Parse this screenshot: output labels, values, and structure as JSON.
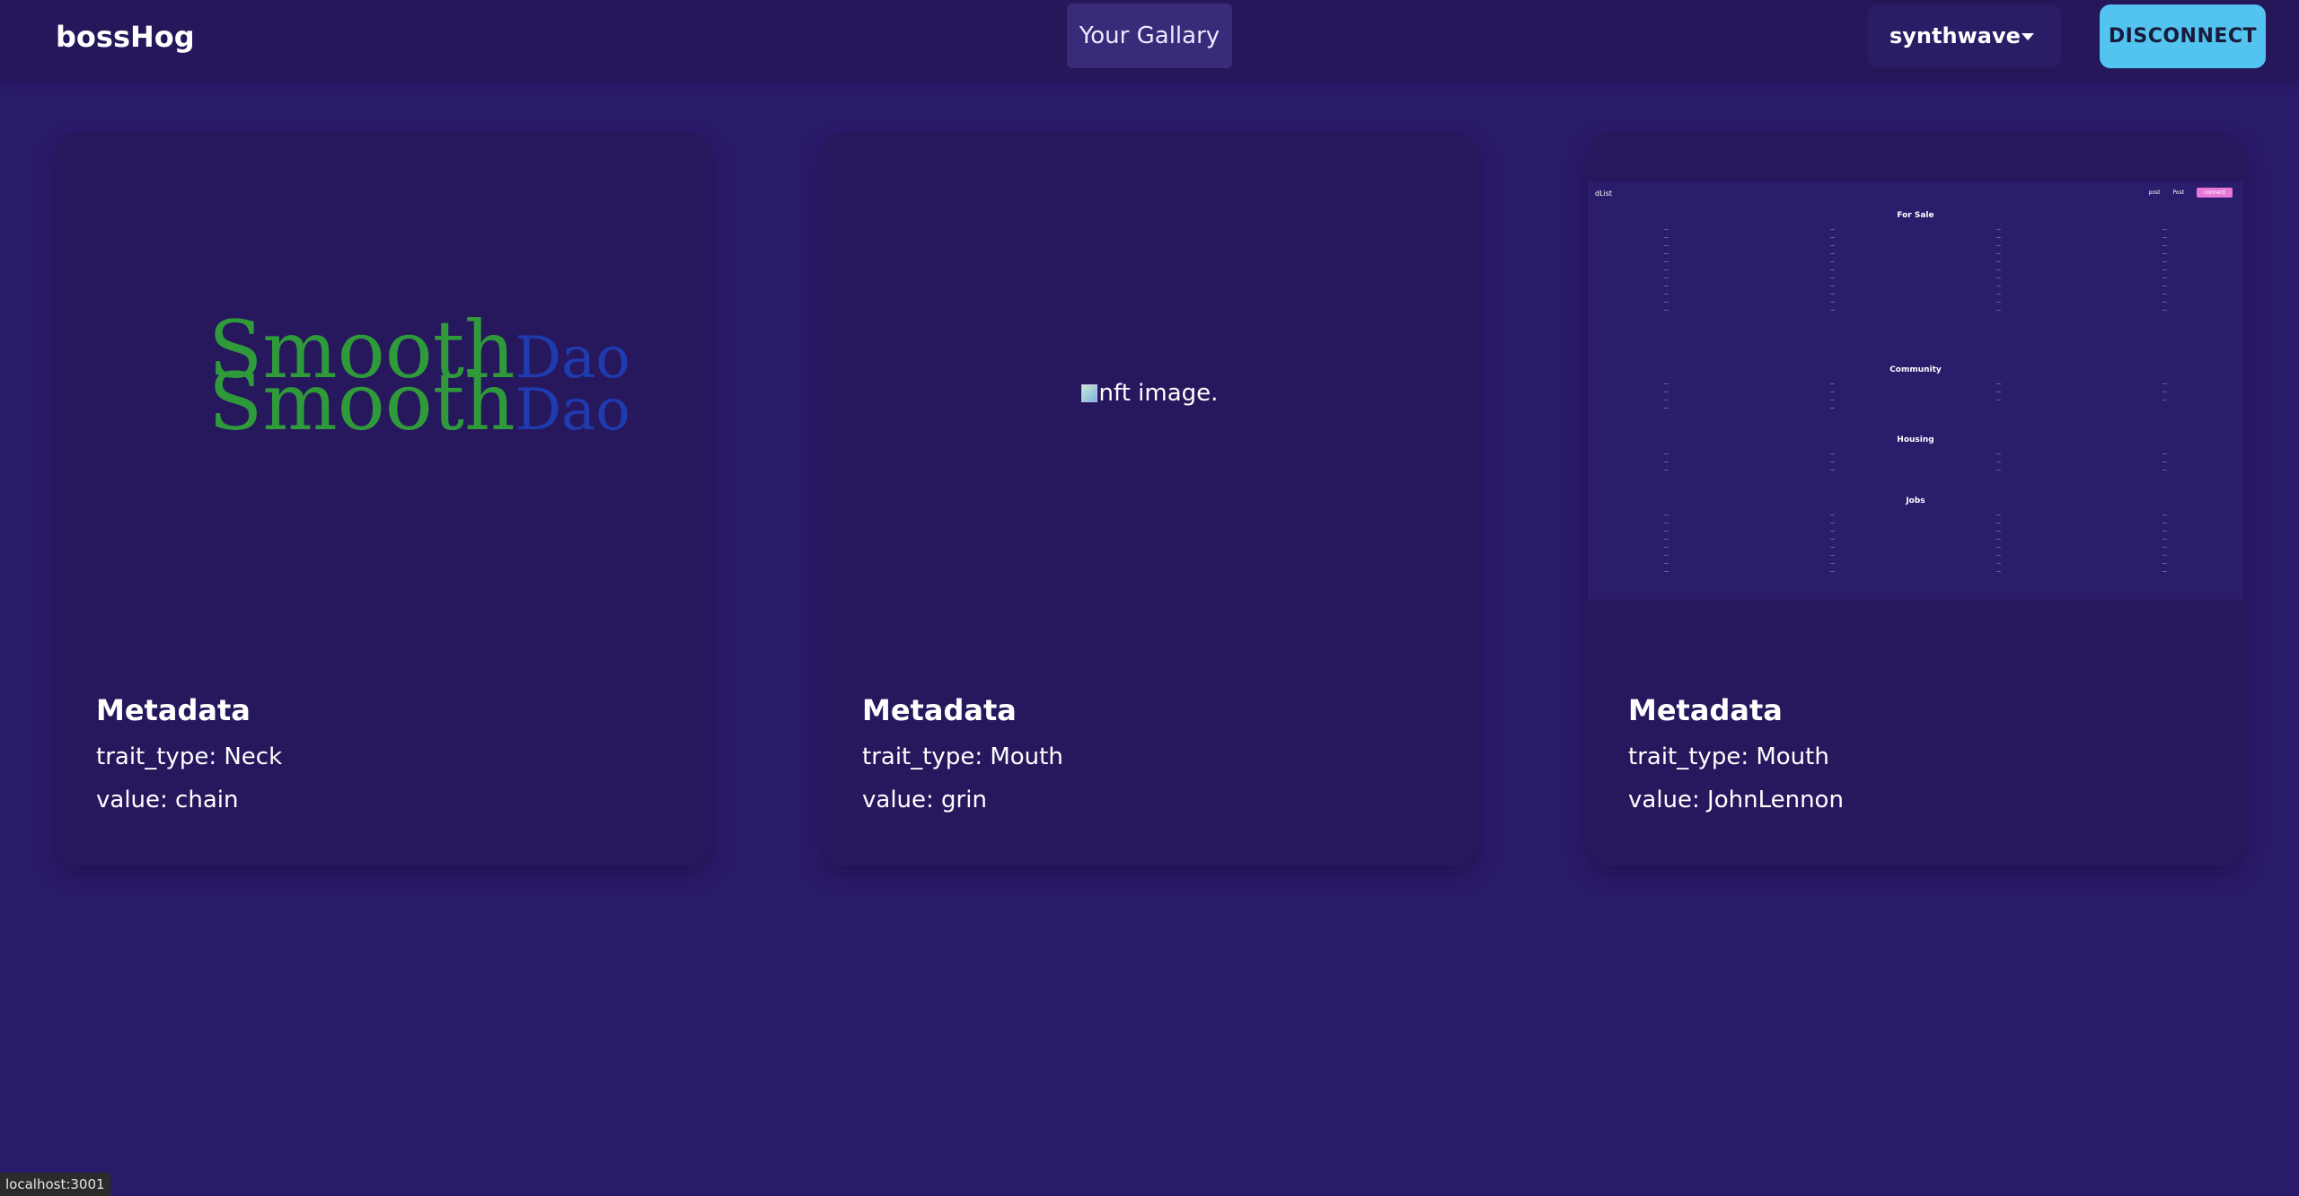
{
  "navbar": {
    "brand": "bossHog",
    "gallery_button": "Your Gallary",
    "theme_select": "synthwave",
    "disconnect_button": "DISCONNECT"
  },
  "cards": [
    {
      "logo_text_top": "Smooth",
      "logo_text_top_suffix": "Dao",
      "logo_text_bottom": "Smooth",
      "logo_text_bottom_suffix": "Dao",
      "meta_title": "Metadata",
      "trait": "trait_type: Neck",
      "value": "value: chain"
    },
    {
      "image_alt": "nft image.",
      "meta_title": "Metadata",
      "trait": "trait_type: Mouth",
      "value": "value: grin"
    },
    {
      "thumb": {
        "brand": "dList",
        "nav_items": [
          "post",
          "Post",
          "connect"
        ],
        "for_sale": "For Sale",
        "community": "Community",
        "housing": "Housing",
        "jobs": "Jobs"
      },
      "meta_title": "Metadata",
      "trait": "trait_type: Mouth",
      "value": "value: JohnLennon"
    }
  ],
  "status_bar": "localhost:3001"
}
